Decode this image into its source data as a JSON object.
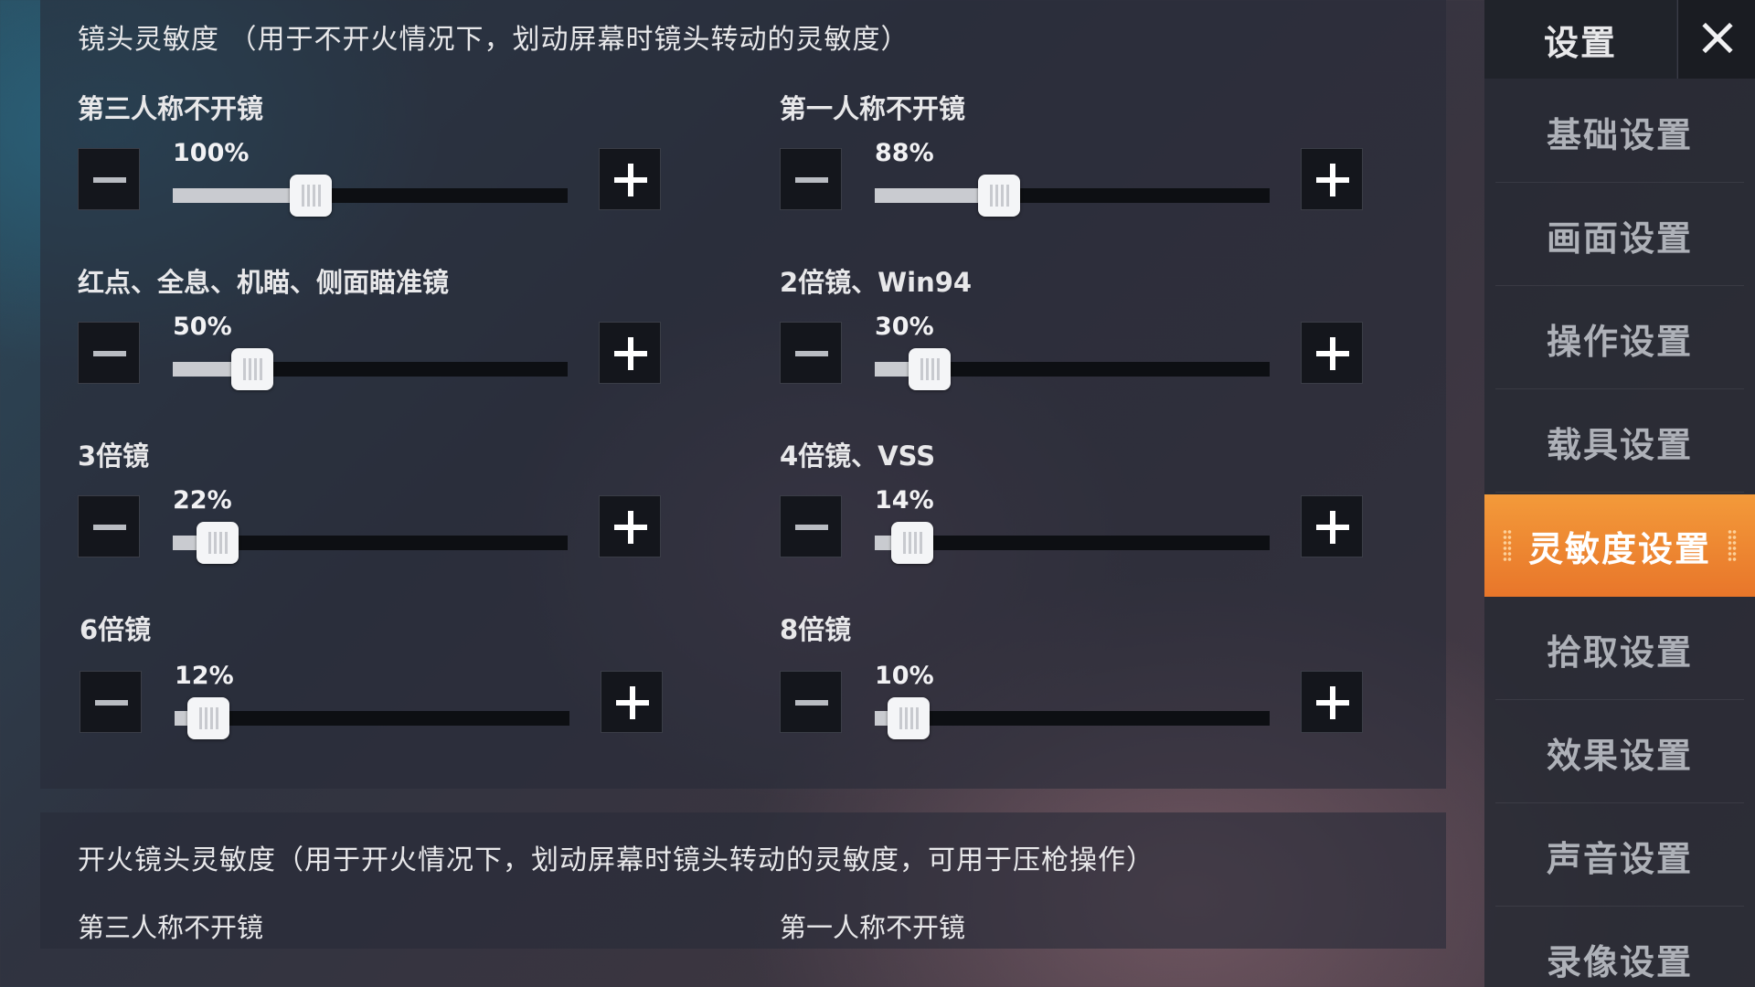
{
  "top_section": {
    "title": "镜头灵敏度 （用于不开火情况下，划动屏幕时镜头转动的灵敏度）",
    "rows": [
      {
        "label": "第三人称不开镜",
        "value": "100%",
        "level": 0.33
      },
      {
        "label": "第一人称不开镜",
        "value": "88%",
        "level": 0.29
      },
      {
        "label": "红点、全息、机瞄、侧面瞄准镜",
        "value": "50%",
        "level": 0.16
      },
      {
        "label": "2倍镜、Win94",
        "value": "30%",
        "level": 0.09
      },
      {
        "label": "3倍镜",
        "value": "22%",
        "level": 0.06
      },
      {
        "label": "4倍镜、VSS",
        "value": "14%",
        "level": 0.04
      },
      {
        "label": "6倍镜",
        "value": "12%",
        "level": 0.03
      },
      {
        "label": "8倍镜",
        "value": "10%",
        "level": 0.03
      }
    ]
  },
  "bottom_section": {
    "title": "开火镜头灵敏度（用于开火情况下，划动屏幕时镜头转动的灵敏度，可用于压枪操作）",
    "labels": [
      "第三人称不开镜",
      "第一人称不开镜"
    ]
  },
  "sidebar": {
    "title": "设置",
    "close_icon": "close-icon",
    "items": [
      {
        "label": "基础设置",
        "active": false
      },
      {
        "label": "画面设置",
        "active": false
      },
      {
        "label": "操作设置",
        "active": false
      },
      {
        "label": "载具设置",
        "active": false
      },
      {
        "label": "灵敏度设置",
        "active": true
      },
      {
        "label": "拾取设置",
        "active": false
      },
      {
        "label": "效果设置",
        "active": false
      },
      {
        "label": "声音设置",
        "active": false
      },
      {
        "label": "录像设置",
        "active": false
      }
    ]
  },
  "colors": {
    "accent": "#f08a34",
    "slider_fill": "#c9cbd0",
    "track": "#0d0f13"
  },
  "icons": {
    "decrease": "minus-icon",
    "increase": "plus-icon"
  }
}
